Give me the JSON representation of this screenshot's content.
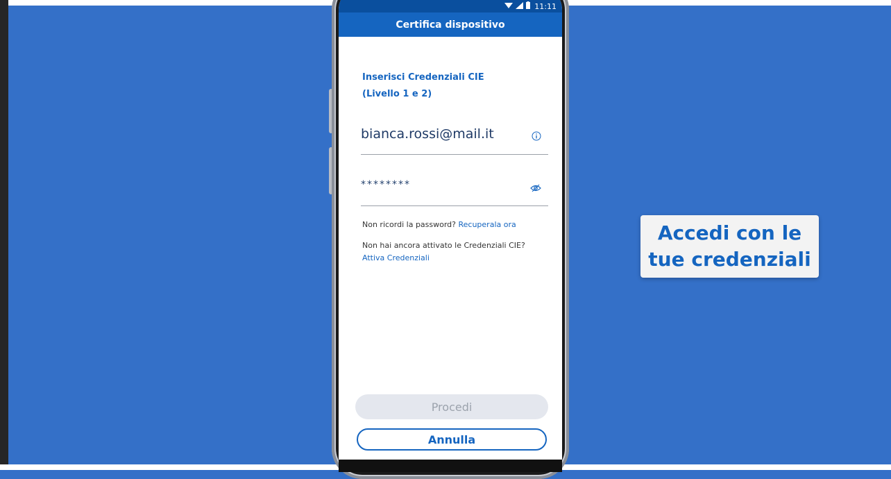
{
  "status_bar": {
    "time": "11:11"
  },
  "header": {
    "title": "Certifica dispositivo"
  },
  "form": {
    "heading_line1": "Inserisci Credenziali CIE",
    "heading_line2": "(Livello 1 e 2)",
    "username_value": "bianca.rossi@mail.it",
    "password_value": "********",
    "forgot_text": "Non ricordi la password? ",
    "forgot_link": "Recuperala ora",
    "activate_text": "Non hai ancora attivato le Credenziali CIE?",
    "activate_link": "Attiva Credenziali"
  },
  "buttons": {
    "procedi": "Procedi",
    "annulla": "Annulla"
  },
  "callout": {
    "line1": "Accedi con le",
    "line2": "tue credenziali"
  },
  "icons": {
    "info": "info-icon",
    "eye": "eye-icon",
    "wifi": "wifi-icon",
    "signal": "signal-icon",
    "battery": "battery-icon"
  },
  "colors": {
    "background": "#3470c8",
    "accent": "#1565c0",
    "status_bar": "#0a4f9e"
  }
}
